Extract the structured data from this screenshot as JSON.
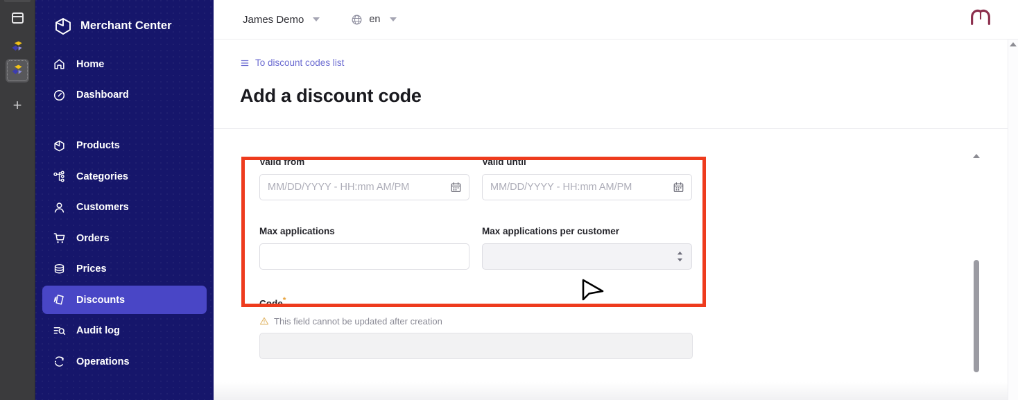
{
  "browser_strip": {
    "buttons": [
      {
        "name": "panel-toggle-icon",
        "label": ""
      },
      {
        "name": "extension-icon-1",
        "label": ""
      },
      {
        "name": "extension-icon-2",
        "label": ""
      }
    ],
    "add_label": "+"
  },
  "sidebar": {
    "brand": "Merchant Center",
    "brand_icon": "cube-icon",
    "items": [
      {
        "label": "Home",
        "icon": "home-icon",
        "active": false
      },
      {
        "label": "Dashboard",
        "icon": "dashboard-icon",
        "active": false
      },
      {
        "label": "Products",
        "icon": "cube-icon",
        "active": false
      },
      {
        "label": "Categories",
        "icon": "categories-tree-icon",
        "active": false
      },
      {
        "label": "Customers",
        "icon": "user-icon",
        "active": false
      },
      {
        "label": "Orders",
        "icon": "cart-icon",
        "active": false
      },
      {
        "label": "Prices",
        "icon": "coins-icon",
        "active": false
      },
      {
        "label": "Discounts",
        "icon": "discount-tag-icon",
        "active": true
      },
      {
        "label": "Audit log",
        "icon": "audit-search-icon",
        "active": false
      },
      {
        "label": "Operations",
        "icon": "operations-refresh-icon",
        "active": false
      }
    ]
  },
  "topbar": {
    "project": "James Demo",
    "project_caret": "chevron-down-icon",
    "locale_icon": "globe-icon",
    "locale": "en",
    "locale_caret": "chevron-down-icon",
    "right_logo": "commercetools-logo"
  },
  "page": {
    "breadcrumb": "To discount codes list",
    "breadcrumb_icon": "list-icon",
    "title": "Add a discount code"
  },
  "form": {
    "valid_from": {
      "label": "Valid from",
      "value": "",
      "placeholder": "MM/DD/YYYY - HH:mm AM/PM",
      "icon": "calendar-icon"
    },
    "valid_until": {
      "label": "Valid until",
      "value": "",
      "placeholder": "MM/DD/YYYY - HH:mm AM/PM",
      "icon": "calendar-icon"
    },
    "max_applications": {
      "label": "Max applications",
      "value": "",
      "placeholder": ""
    },
    "max_applications_per_customer": {
      "label": "Max applications per customer",
      "value": "",
      "placeholder": "",
      "icon": "number-stepper-icon"
    },
    "code": {
      "label": "Code",
      "required_marker": "*",
      "hint": "This field cannot be updated after creation",
      "hint_icon": "warning-triangle-icon",
      "value": "",
      "placeholder": ""
    }
  },
  "annotation": {
    "name": "red-highlight-box",
    "color": "#ee3b1d"
  },
  "colors": {
    "sidebar_bg": "#16166b",
    "sidebar_active": "#4946c6",
    "accent_link": "#6b6bd1",
    "annotation_red": "#ee3b1d",
    "logo_maroon": "#8c2f4d",
    "hint_amber": "#e8a33d"
  }
}
